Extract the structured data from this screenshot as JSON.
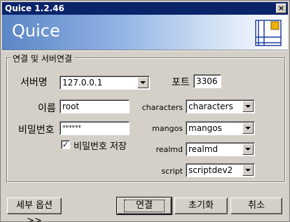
{
  "window": {
    "title": "Quice 1.2.46",
    "close_label": "×",
    "banner_title": "Quice"
  },
  "connection": {
    "legend": "연결 및 서버연결",
    "server_label": "서버명",
    "server_value": "127.0.0.1",
    "port_label": "포트",
    "port_value": "3306",
    "name_label": "이름",
    "name_value": "root",
    "password_label": "비밀번호",
    "password_value": "******",
    "save_password_label": "비밀번호 저장",
    "save_password_checked": "✓"
  },
  "databases": {
    "characters_label": "characters",
    "characters_value": "characters",
    "mangos_label": "mangos",
    "mangos_value": "mangos",
    "realmd_label": "realmd",
    "realmd_value": "realmd",
    "script_label": "script",
    "script_value": "scriptdev2"
  },
  "buttons": {
    "details": "세부 옵션 >>",
    "connect": "연결",
    "reset": "초기화",
    "cancel": "취소"
  },
  "colors": {
    "titlebar": "#0a246a",
    "logo_accent": "#f0b000",
    "logo_grid": "#1c3fa0"
  }
}
